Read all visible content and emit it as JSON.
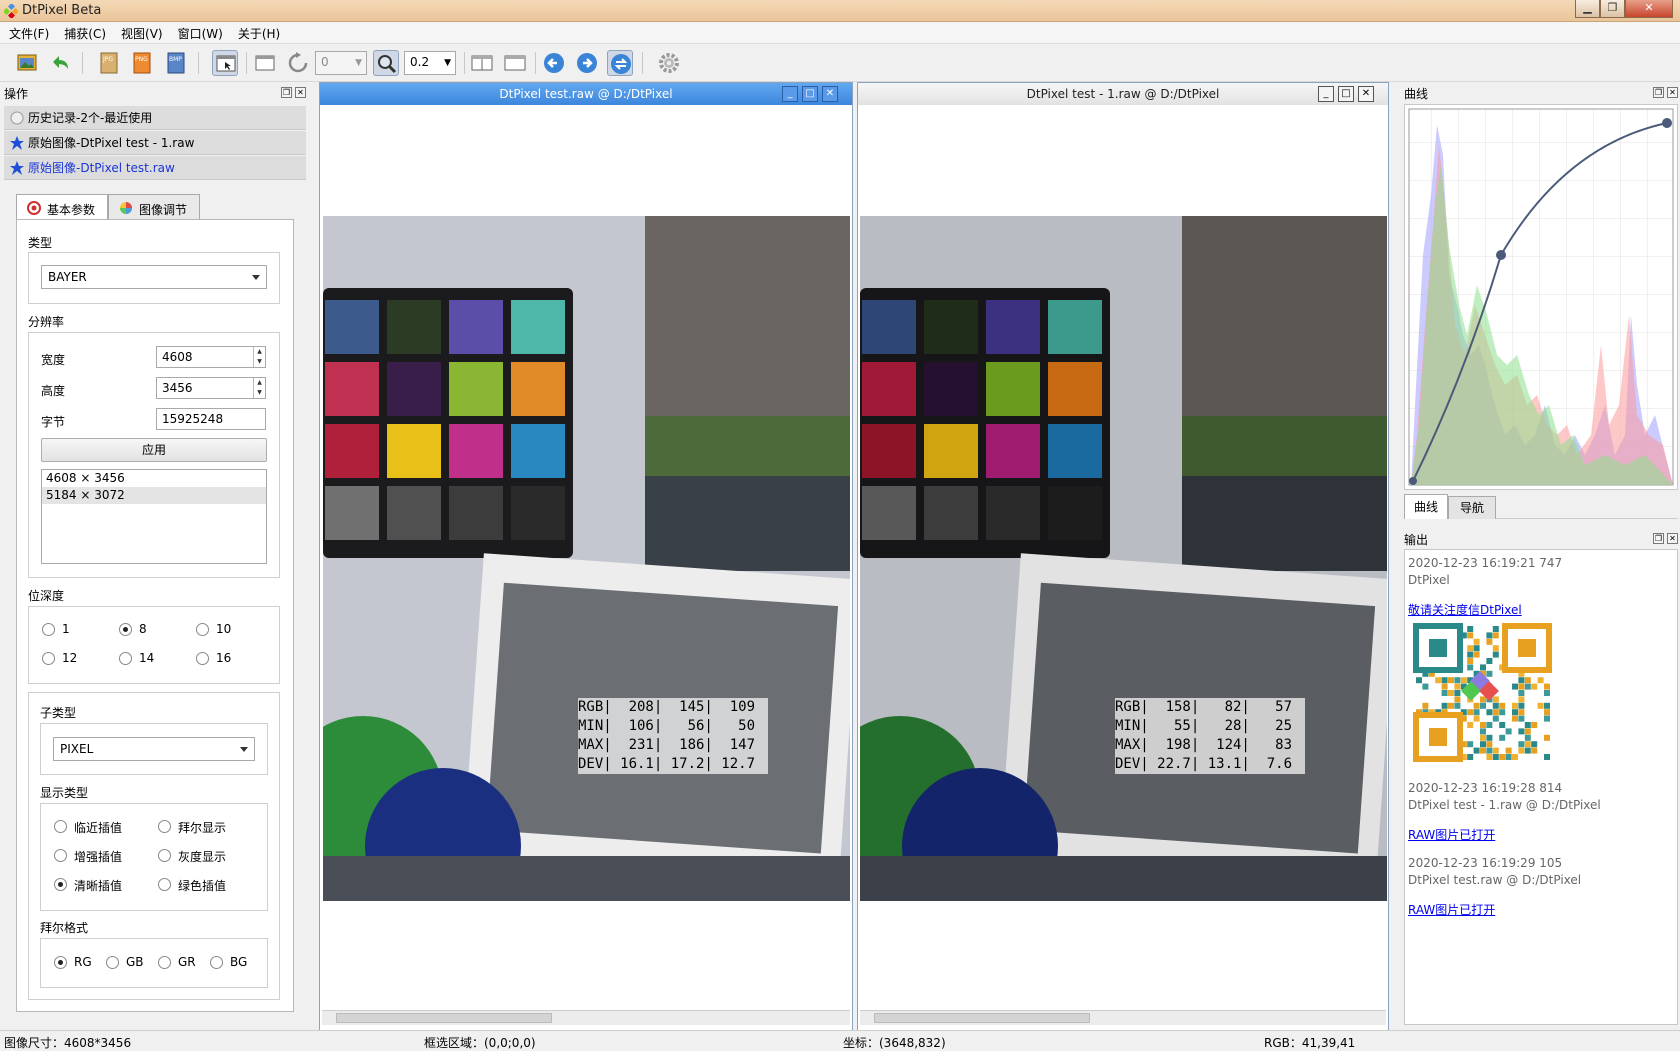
{
  "app": {
    "title": "DtPixel Beta"
  },
  "menu": [
    "文件(F)",
    "捕获(C)",
    "视图(V)",
    "窗口(W)",
    "关于(H)"
  ],
  "toolbar": {
    "frame_value": "0",
    "zoom_value": "0.2"
  },
  "left_panel": {
    "title": "操作",
    "history": [
      {
        "label": "历史记录-2个-最近使用",
        "active": false
      },
      {
        "label": "原始图像-DtPixel test - 1.raw",
        "active": false
      },
      {
        "label": "原始图像-DtPixel test.raw",
        "active": true
      }
    ],
    "tabs": [
      "基本参数",
      "图像调节"
    ],
    "type_label": "类型",
    "type_value": "BAYER",
    "resolution_label": "分辨率",
    "width_label": "宽度",
    "width_value": "4608",
    "height_label": "高度",
    "height_value": "3456",
    "bytes_label": "字节",
    "bytes_value": "15925248",
    "apply_label": "应用",
    "res_list": [
      "4608 × 3456",
      "5184 × 3072"
    ],
    "bitdepth_label": "位深度",
    "bitdepth_options": [
      "1",
      "8",
      "10",
      "12",
      "14",
      "16"
    ],
    "bitdepth_selected": "8",
    "subtype_label": "子类型",
    "subtype_value": "PIXEL",
    "display_label": "显示类型",
    "display_options": [
      "临近插值",
      "拜尔显示",
      "增强插值",
      "灰度显示",
      "清晰插值",
      "绿色插值"
    ],
    "display_selected": "清晰插值",
    "bayer_label": "拜尔格式",
    "bayer_options": [
      "RG",
      "GB",
      "GR",
      "BG"
    ],
    "bayer_selected": "RG"
  },
  "image_windows": [
    {
      "title": "DtPixel test.raw @ D:/DtPixel",
      "stats": [
        [
          "RGB",
          "208",
          "145",
          "109"
        ],
        [
          "MIN",
          "106",
          "56",
          "50"
        ],
        [
          "MAX",
          "231",
          "186",
          "147"
        ],
        [
          "DEV",
          "16.1",
          "17.2",
          "12.7"
        ]
      ]
    },
    {
      "title": "DtPixel test - 1.raw @ D:/DtPixel",
      "stats": [
        [
          "RGB",
          "158",
          "82",
          "57"
        ],
        [
          "MIN",
          "55",
          "28",
          "25"
        ],
        [
          "MAX",
          "198",
          "124",
          "83"
        ],
        [
          "DEV",
          "22.7",
          "13.1",
          "7.6"
        ]
      ]
    }
  ],
  "right_panel": {
    "curve_title": "曲线",
    "tabs": [
      "曲线",
      "导航"
    ],
    "output_title": "输出",
    "log": [
      {
        "time": "2020-12-23 16:19:21 747",
        "text": "DtPixel",
        "link": "敬请关注度信DtPixel "
      },
      {
        "time": "2020-12-23 16:19:28 814",
        "text": "DtPixel test - 1.raw @ D:/DtPixel",
        "link": "RAW图片已打开 "
      },
      {
        "time": "2020-12-23 16:19:29 105",
        "text": "DtPixel test.raw @ D:/DtPixel",
        "link": "RAW图片已打开 "
      }
    ]
  },
  "status": {
    "image_size": "图像尺寸：4608*3456",
    "selection": "框选区域：(0,0;0,0)",
    "coords": "坐标：(3648,832)",
    "rgb": "RGB：41,39,41"
  }
}
